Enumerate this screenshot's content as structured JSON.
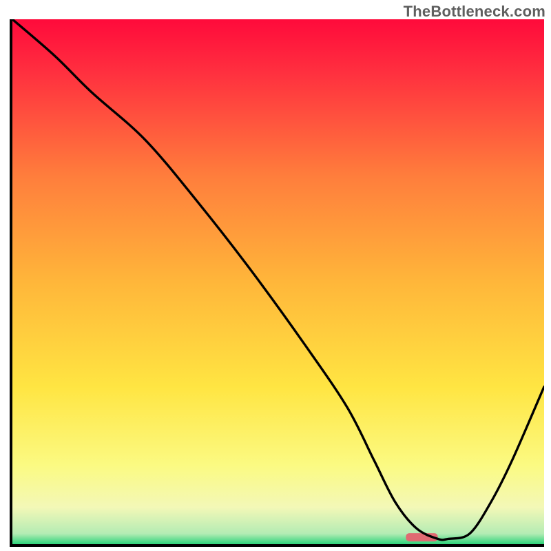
{
  "watermark": "TheBottleneck.com",
  "chart_data": {
    "type": "line",
    "title": "",
    "xlabel": "",
    "ylabel": "",
    "xlim": [
      0,
      100
    ],
    "ylim": [
      0,
      100
    ],
    "gradient_stops": [
      {
        "offset": 0,
        "color": "#ff0a3b"
      },
      {
        "offset": 10,
        "color": "#ff2f3f"
      },
      {
        "offset": 30,
        "color": "#ff7e3c"
      },
      {
        "offset": 50,
        "color": "#ffb63a"
      },
      {
        "offset": 70,
        "color": "#ffe542"
      },
      {
        "offset": 85,
        "color": "#fbfa82"
      },
      {
        "offset": 93,
        "color": "#f3f8b7"
      },
      {
        "offset": 98,
        "color": "#b4ecb4"
      },
      {
        "offset": 100,
        "color": "#2dd37a"
      }
    ],
    "series": [
      {
        "name": "bottleneck-curve",
        "x": [
          0,
          8,
          15,
          25,
          35,
          45,
          55,
          63,
          68,
          72,
          76,
          80,
          82,
          86,
          90,
          94,
          100
        ],
        "y": [
          100,
          93,
          86,
          77,
          65,
          52,
          38,
          26,
          16,
          8,
          3,
          1,
          1,
          2,
          8,
          16,
          30
        ]
      }
    ],
    "marker": {
      "x_start": 74,
      "x_end": 80,
      "y": 1.3,
      "color": "#e06a72"
    }
  }
}
